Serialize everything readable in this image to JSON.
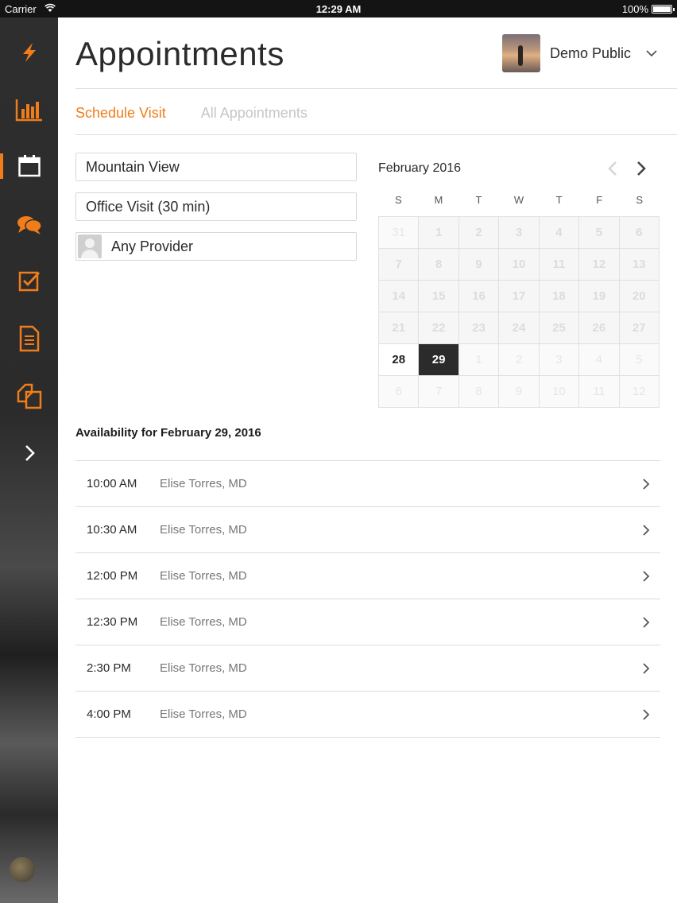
{
  "status_bar": {
    "carrier": "Carrier",
    "time": "12:29 AM",
    "battery": "100%"
  },
  "sidebar": {
    "items": [
      {
        "name": "logo",
        "icon": "lightning-icon"
      },
      {
        "name": "dashboard",
        "icon": "bar-chart-icon"
      },
      {
        "name": "appointments",
        "icon": "calendar-icon",
        "active": true
      },
      {
        "name": "messages",
        "icon": "chat-icon"
      },
      {
        "name": "tasks",
        "icon": "checkbox-icon"
      },
      {
        "name": "documents",
        "icon": "document-icon"
      },
      {
        "name": "records",
        "icon": "copy-icon"
      },
      {
        "name": "expand",
        "icon": "chevron-right-icon"
      }
    ],
    "accent_color": "#f07d1a"
  },
  "header": {
    "title": "Appointments",
    "user_name": "Demo Public"
  },
  "tabs": [
    {
      "label": "Schedule Visit",
      "active": true
    },
    {
      "label": "All Appointments",
      "active": false
    }
  ],
  "filters": {
    "location": "Mountain View",
    "visit_type": "Office Visit (30 min)",
    "provider": "Any Provider"
  },
  "calendar": {
    "month_label": "February 2016",
    "weekdays": [
      "S",
      "M",
      "T",
      "W",
      "T",
      "F",
      "S"
    ],
    "weeks": [
      [
        {
          "d": "31",
          "s": "faded"
        },
        {
          "d": "1",
          "s": "off"
        },
        {
          "d": "2",
          "s": "off"
        },
        {
          "d": "3",
          "s": "off"
        },
        {
          "d": "4",
          "s": "off"
        },
        {
          "d": "5",
          "s": "off"
        },
        {
          "d": "6",
          "s": "off"
        }
      ],
      [
        {
          "d": "7",
          "s": "off"
        },
        {
          "d": "8",
          "s": "off"
        },
        {
          "d": "9",
          "s": "off"
        },
        {
          "d": "10",
          "s": "off"
        },
        {
          "d": "11",
          "s": "off"
        },
        {
          "d": "12",
          "s": "off"
        },
        {
          "d": "13",
          "s": "off"
        }
      ],
      [
        {
          "d": "14",
          "s": "off"
        },
        {
          "d": "15",
          "s": "off"
        },
        {
          "d": "16",
          "s": "off"
        },
        {
          "d": "17",
          "s": "off"
        },
        {
          "d": "18",
          "s": "off"
        },
        {
          "d": "19",
          "s": "off"
        },
        {
          "d": "20",
          "s": "off"
        }
      ],
      [
        {
          "d": "21",
          "s": "off"
        },
        {
          "d": "22",
          "s": "off"
        },
        {
          "d": "23",
          "s": "off"
        },
        {
          "d": "24",
          "s": "off"
        },
        {
          "d": "25",
          "s": "off"
        },
        {
          "d": "26",
          "s": "off"
        },
        {
          "d": "27",
          "s": "off"
        }
      ],
      [
        {
          "d": "28",
          "s": "avail"
        },
        {
          "d": "29",
          "s": "selected"
        },
        {
          "d": "1",
          "s": "faded"
        },
        {
          "d": "2",
          "s": "faded"
        },
        {
          "d": "3",
          "s": "faded"
        },
        {
          "d": "4",
          "s": "faded"
        },
        {
          "d": "5",
          "s": "faded"
        }
      ],
      [
        {
          "d": "6",
          "s": "faded"
        },
        {
          "d": "7",
          "s": "faded"
        },
        {
          "d": "8",
          "s": "faded"
        },
        {
          "d": "9",
          "s": "faded"
        },
        {
          "d": "10",
          "s": "faded"
        },
        {
          "d": "11",
          "s": "faded"
        },
        {
          "d": "12",
          "s": "faded"
        }
      ]
    ]
  },
  "availability": {
    "title": "Availability for February 29, 2016",
    "slots": [
      {
        "time": "10:00 AM",
        "provider": "Elise Torres, MD"
      },
      {
        "time": "10:30 AM",
        "provider": "Elise Torres, MD"
      },
      {
        "time": "12:00 PM",
        "provider": "Elise Torres, MD"
      },
      {
        "time": "12:30 PM",
        "provider": "Elise Torres, MD"
      },
      {
        "time": "2:30 PM",
        "provider": "Elise Torres, MD"
      },
      {
        "time": "4:00 PM",
        "provider": "Elise Torres, MD"
      }
    ]
  }
}
